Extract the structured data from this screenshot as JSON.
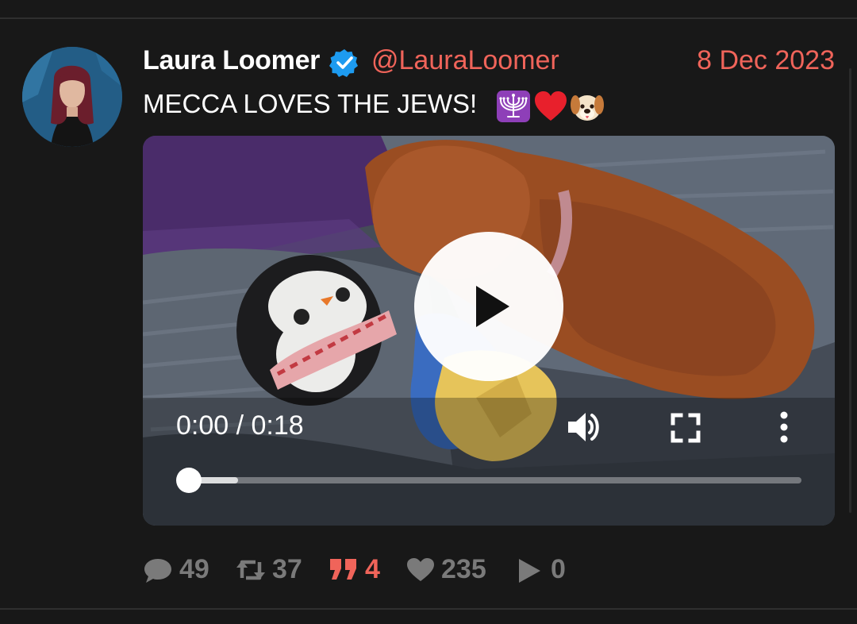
{
  "post": {
    "author_name": "Laura Loomer",
    "handle": "@LauraLoomer",
    "date": "8 Dec 2023",
    "text": "MECCA LOVES THE JEWS!",
    "emojis": [
      "menorah-emoji",
      "red-heart-emoji",
      "dog-face-emoji"
    ]
  },
  "video": {
    "time_display": "0:00 / 0:18",
    "progress_fraction": 0.0,
    "buffered_fraction": 0.08,
    "icons": [
      "play-icon",
      "volume-icon",
      "fullscreen-icon",
      "more-options-icon"
    ]
  },
  "stats": {
    "replies": "49",
    "retweets": "37",
    "quotes": "4",
    "likes": "235",
    "views": "0"
  },
  "colors": {
    "background": "#181818",
    "accent": "#f0645a",
    "muted": "#7a7a7a",
    "verified_blue": "#1d9bf0"
  }
}
